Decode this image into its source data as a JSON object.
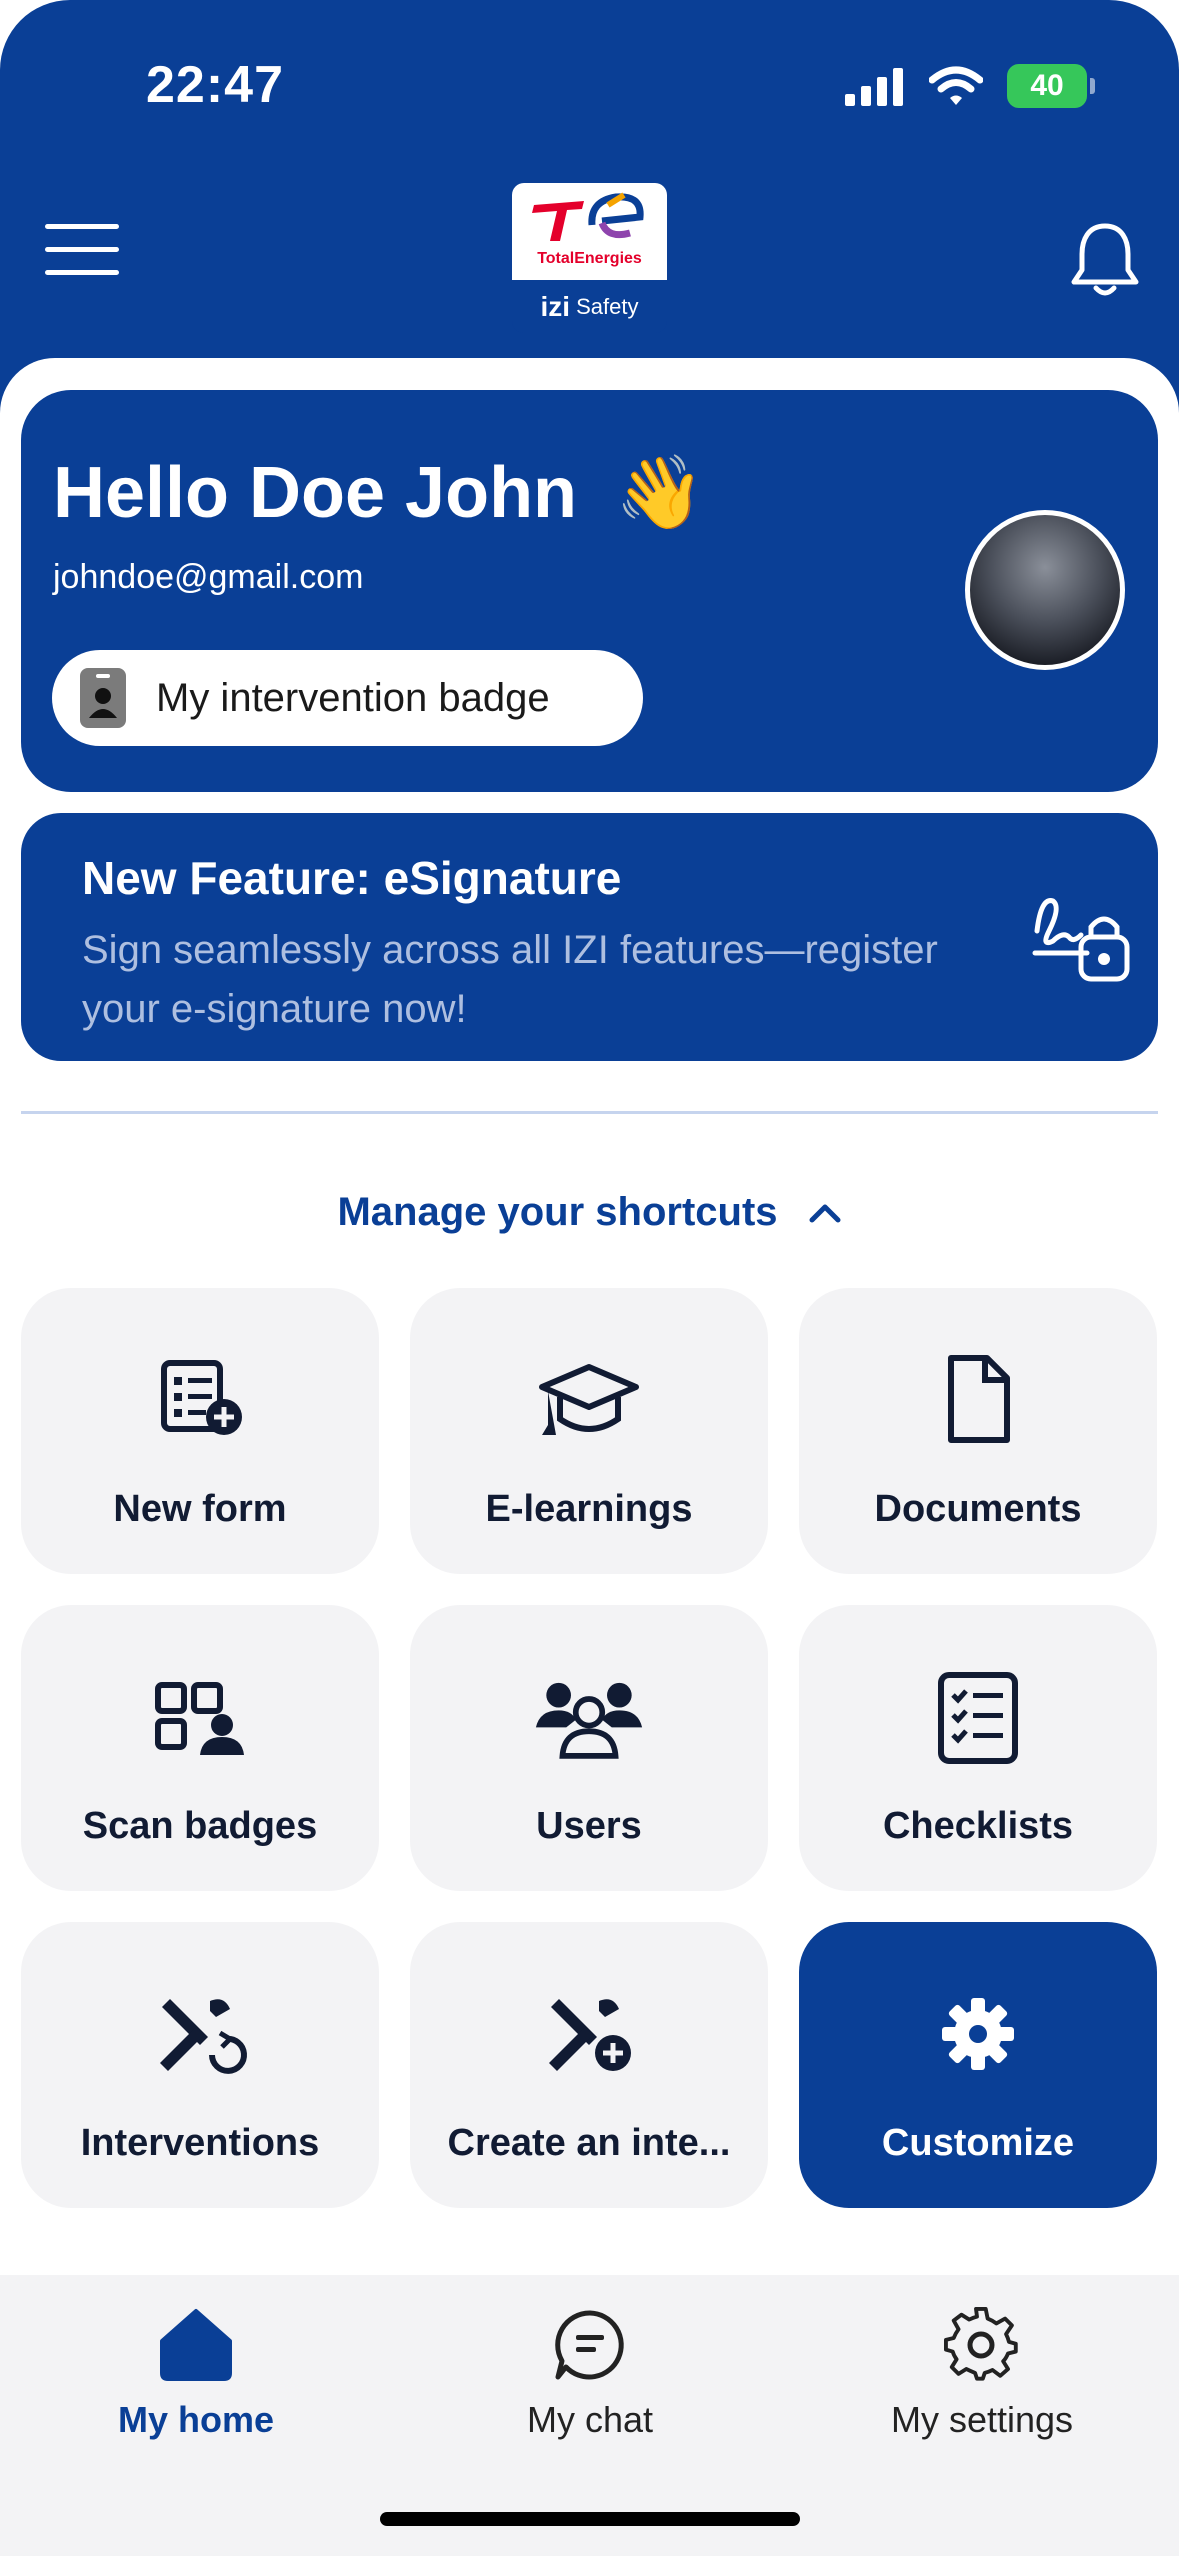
{
  "status_bar": {
    "time": "22:47",
    "battery": "40"
  },
  "header": {
    "logo_brand": "TotalEnergies",
    "logo_app_prefix": "izi",
    "logo_app_suffix": "Safety"
  },
  "greeting": {
    "title": "Hello Doe John",
    "emoji": "👋",
    "email": "johndoe@gmail.com",
    "badge_button": "My intervention badge"
  },
  "feature": {
    "title": "New Feature: eSignature",
    "description": "Sign seamlessly across all IZI features—register your e-signature now!"
  },
  "shortcuts": {
    "manage_label": "Manage your shortcuts",
    "tiles": [
      {
        "label": "New form",
        "icon": "new-form-icon"
      },
      {
        "label": "E-learnings",
        "icon": "graduation-cap-icon"
      },
      {
        "label": "Documents",
        "icon": "document-icon"
      },
      {
        "label": "Scan badges",
        "icon": "qr-user-icon"
      },
      {
        "label": "Users",
        "icon": "users-icon"
      },
      {
        "label": "Checklists",
        "icon": "checklist-icon"
      },
      {
        "label": "Interventions",
        "icon": "tools-refresh-icon"
      },
      {
        "label": "Create an inte...",
        "icon": "tools-add-icon"
      },
      {
        "label": "Customize",
        "icon": "gear-icon"
      }
    ]
  },
  "nav": {
    "items": [
      {
        "label": "My home",
        "icon": "home-icon",
        "active": true
      },
      {
        "label": "My chat",
        "icon": "chat-icon",
        "active": false
      },
      {
        "label": "My settings",
        "icon": "settings-icon",
        "active": false
      }
    ]
  },
  "colors": {
    "primary": "#0a3f96",
    "tile_bg": "#f3f3f5",
    "battery": "#36c75a"
  }
}
